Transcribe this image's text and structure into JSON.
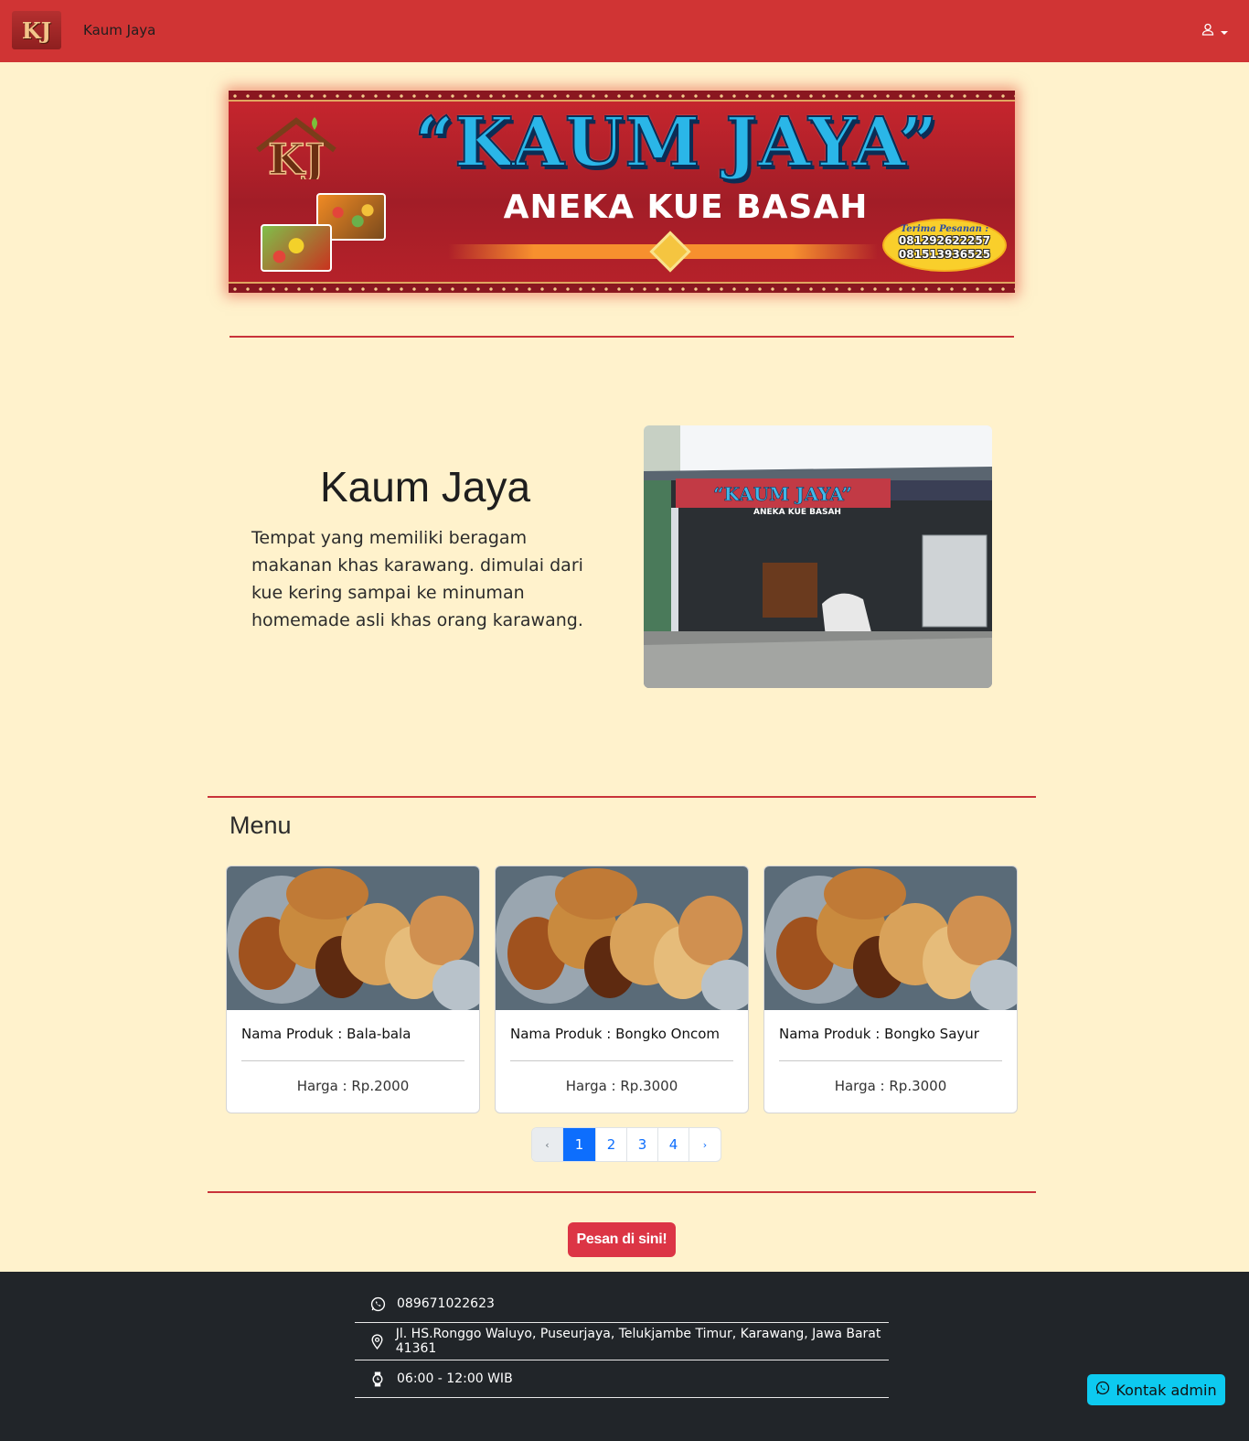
{
  "navbar": {
    "logo_text": "KJ",
    "brand": "Kaum Jaya"
  },
  "banner": {
    "logo_text": "KJ",
    "title": "“KAUM JAYA”",
    "subtitle": "ANEKA KUE BASAH",
    "order_label": "Terima Pesanan :",
    "phones": [
      "081292622257",
      "081513936525"
    ]
  },
  "about": {
    "title": "Kaum Jaya",
    "description": "Tempat yang memiliki beragam makanan khas karawang. dimulai dari kue kering sampai ke minuman homemade asli khas orang karawang.",
    "photo_sign_title": "“KAUM JAYA”",
    "photo_sign_sub": "ANEKA KUE BASAH"
  },
  "menu": {
    "title": "Menu",
    "items": [
      {
        "name": "Nama Produk : Bala-bala",
        "price": "Harga : Rp.2000"
      },
      {
        "name": "Nama Produk : Bongko Oncom",
        "price": "Harga : Rp.3000"
      },
      {
        "name": "Nama Produk : Bongko Sayur",
        "price": "Harga : Rp.3000"
      }
    ]
  },
  "pagination": {
    "prev": "‹",
    "pages": [
      "1",
      "2",
      "3",
      "4"
    ],
    "active": "1",
    "next": "›"
  },
  "order_button": "Pesan di sini!",
  "footer": {
    "phone": "089671022623",
    "address": "Jl. HS.Ronggo Waluyo, Puseurjaya, Telukjambe Timur, Karawang, Jawa Barat 41361",
    "hours": "06:00 - 12:00 WIB"
  },
  "contact_button": "Kontak admin",
  "colors": {
    "navbar": "#d03434",
    "page_background": "#fff2cc",
    "divider": "#c9333a",
    "order_button": "#dc3545",
    "footer": "#212529",
    "contact_button": "#0dcaf0",
    "pagination_active": "#0d6efd"
  },
  "icons": {
    "user_menu": "user-icon",
    "phone": "whatsapp-icon",
    "address": "location-pin-icon",
    "hours": "watch-icon"
  }
}
